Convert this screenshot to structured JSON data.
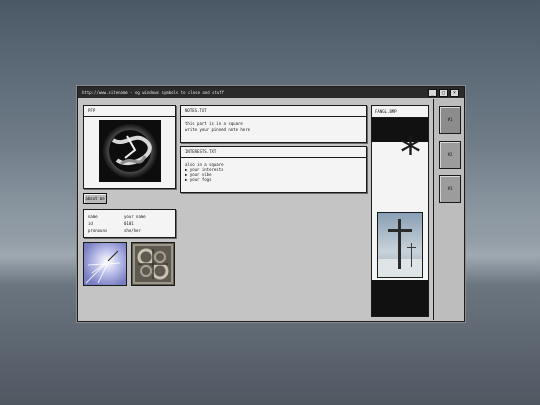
{
  "window": {
    "title": "http://www.sitename - og windows symbols to close and stuff",
    "controls": {
      "minimize": "_",
      "maximize": "□",
      "close": "×"
    }
  },
  "pfp": {
    "label": "PFP"
  },
  "about_button": {
    "label": "about me"
  },
  "info": {
    "rows": [
      {
        "key": "name",
        "value": "your name"
      },
      {
        "key": "id",
        "value": "0101"
      },
      {
        "key": "pronouns",
        "value": "she/her"
      }
    ]
  },
  "notes": {
    "title": "NOTES.TXT",
    "lines": [
      "this part is in a square",
      "write your pinned note here"
    ]
  },
  "interests": {
    "title": "INTERESTS.TXT",
    "lines": [
      "also in a square",
      "▶ your interests",
      "▶ your vibe",
      "▶ your fogs"
    ]
  },
  "fangl": {
    "title": "FANGL.BMP",
    "asterisk": "*"
  },
  "sidebar": {
    "buttons": [
      "#1",
      "#2",
      "#3"
    ]
  },
  "colors": {
    "window_bg": "#c4c4c4",
    "titlebar_bg": "#2b2b2b",
    "panel_bg": "#f4f4f4"
  }
}
